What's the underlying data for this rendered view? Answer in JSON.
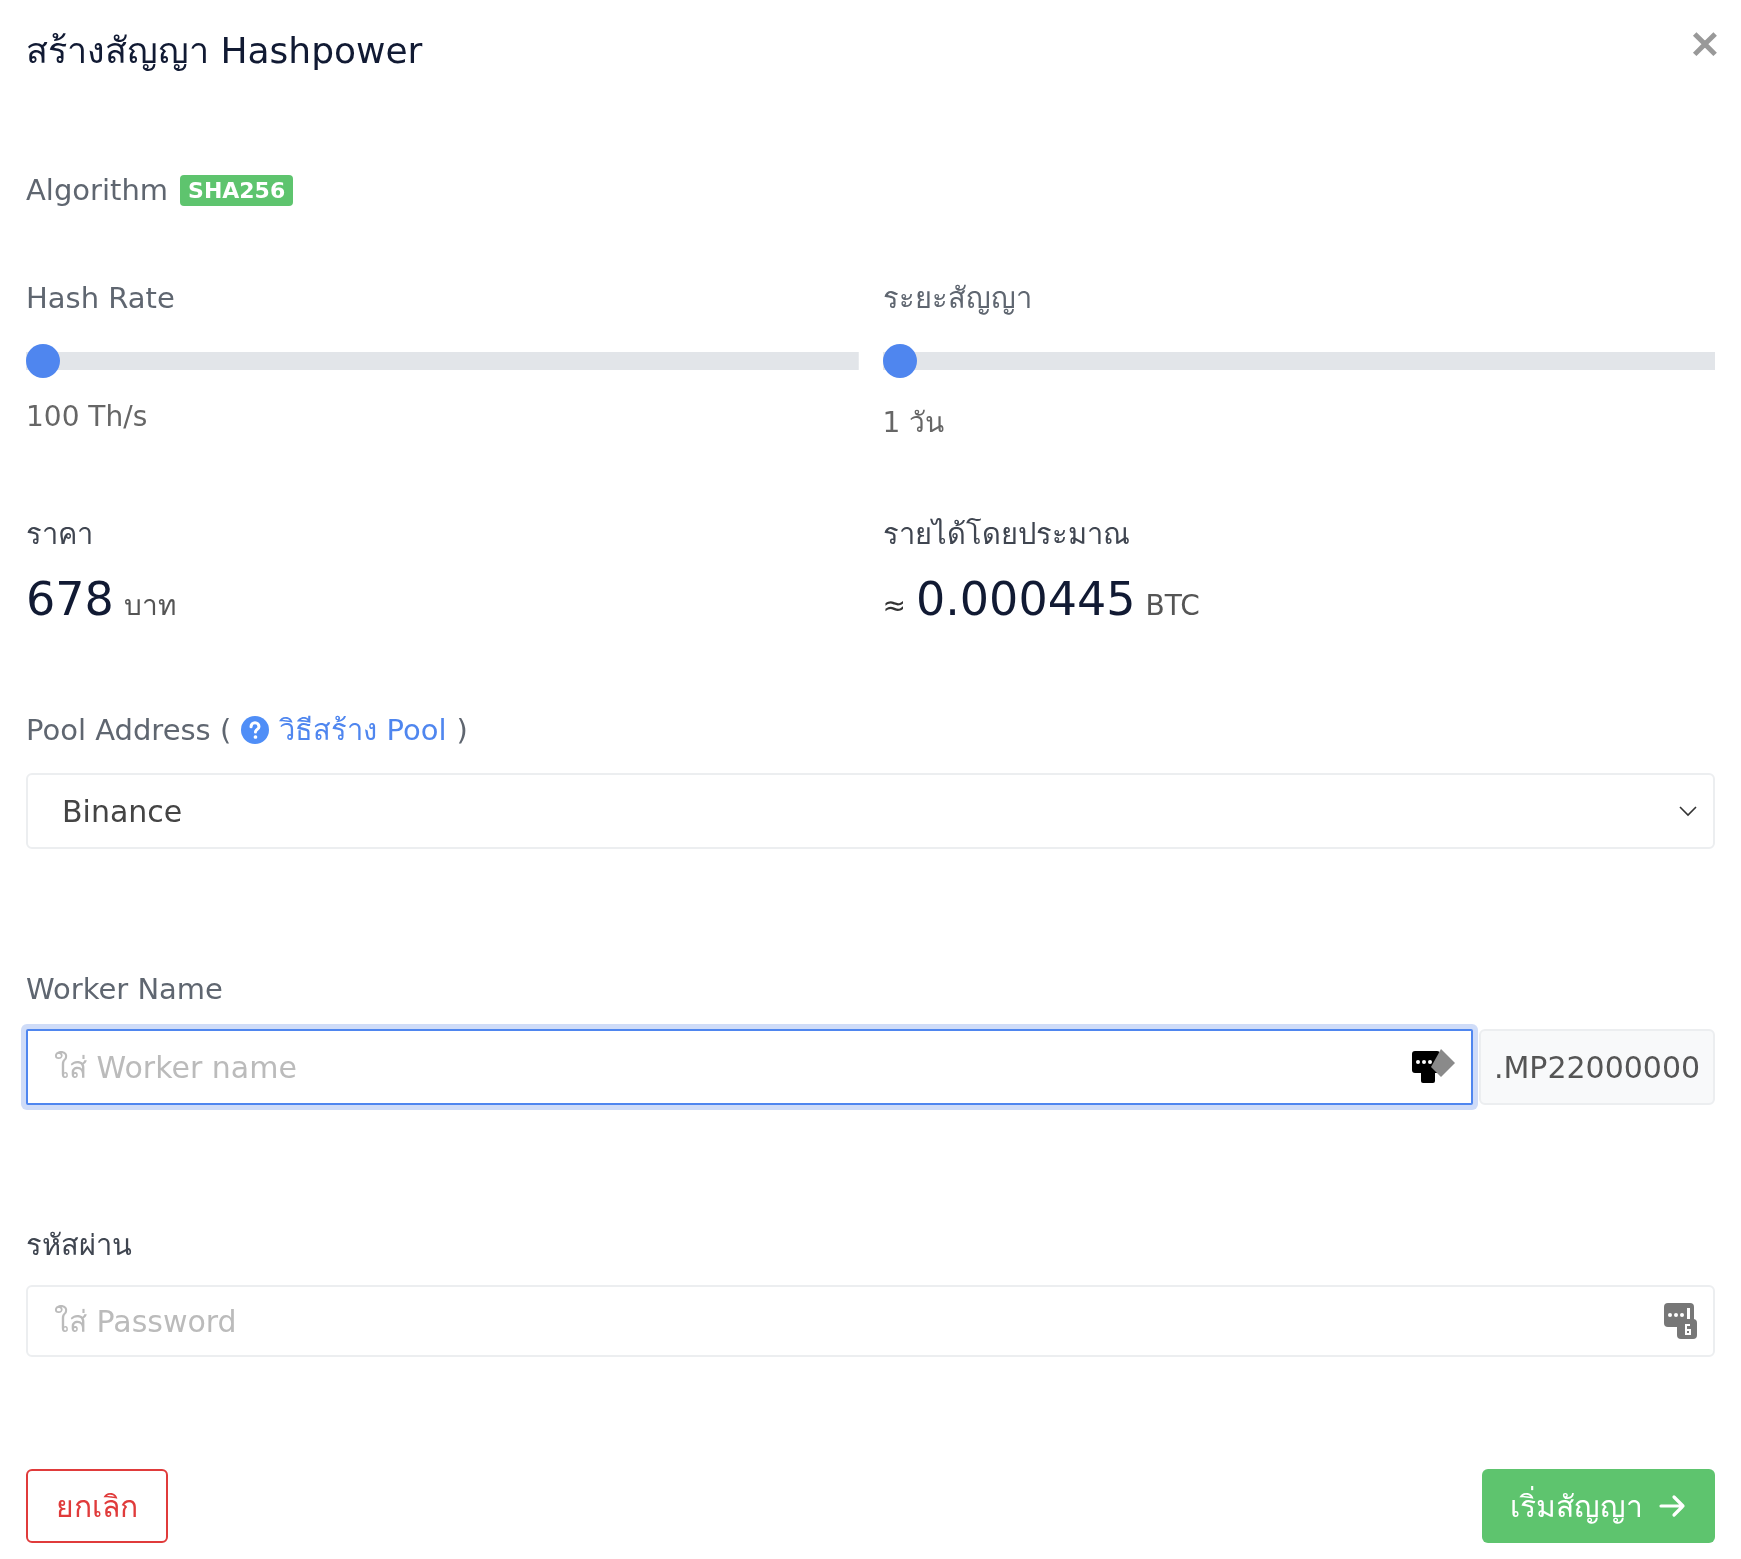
{
  "dialog": {
    "title": "สร้างสัญญา Hashpower",
    "close": "✕"
  },
  "algorithm": {
    "label": "Algorithm",
    "badge": "SHA256"
  },
  "sliders": [
    {
      "label": "Hash Rate",
      "level": 0,
      "reading": "100 Th/s"
    },
    {
      "label": "ระยะสัญญา",
      "level": 0,
      "reading": "1 วัน"
    }
  ],
  "price": {
    "label": "ราคา",
    "value": "678",
    "unit": "บาท"
  },
  "earnings": {
    "label": "รายได้โดยประมาณ",
    "prefix": "≈",
    "value": "0.000445",
    "unit": "BTC"
  },
  "pool": {
    "label": "Pool Address (",
    "link": "วิธีสร้าง Pool",
    "label_end": ")",
    "value": "Binance"
  },
  "worker": {
    "label": "Worker Name",
    "placeholder": "ใส่ Worker name",
    "suffix": ".MP22000000",
    "focused": true
  },
  "password": {
    "label": "รหัสผ่าน",
    "placeholder": "ใส่ Password"
  },
  "buttons": {
    "cancel": "ยกเลิก",
    "submit": "เริ่มสัญญา"
  }
}
